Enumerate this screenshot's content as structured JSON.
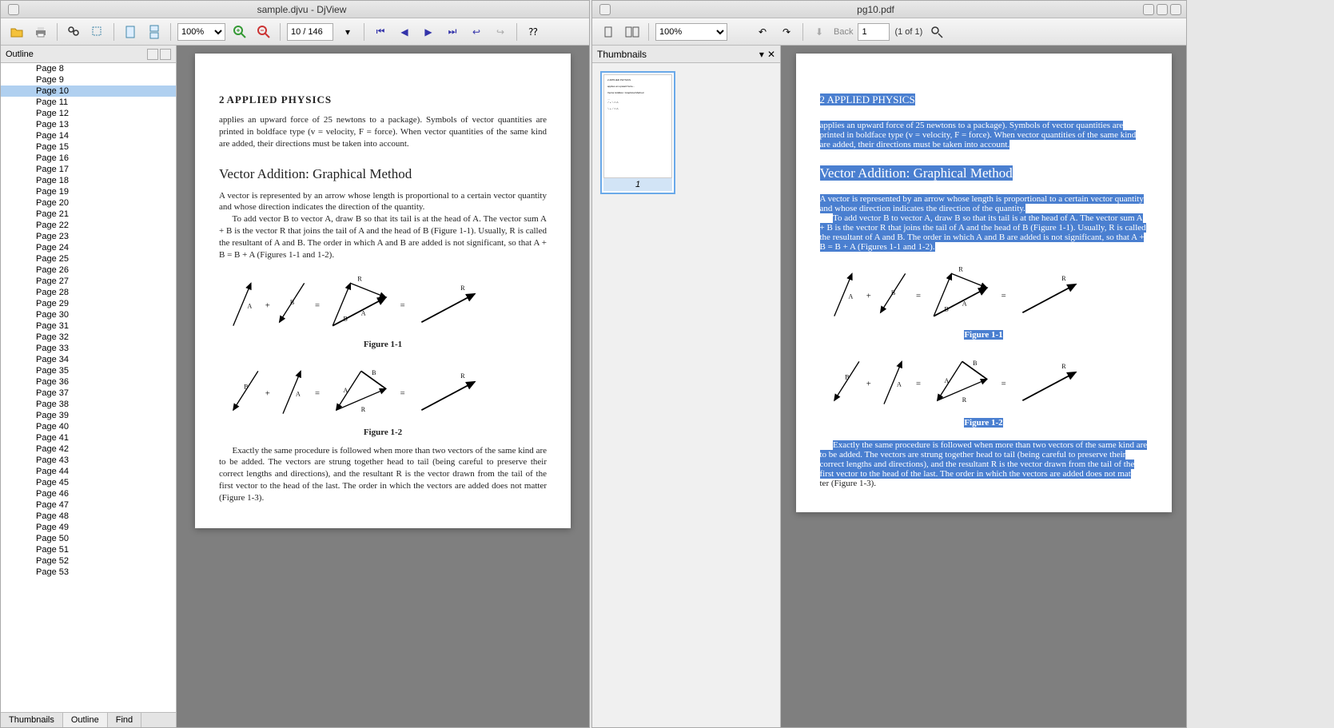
{
  "left": {
    "title": "sample.djvu - DjView",
    "toolbar": {
      "zoom": "100%",
      "page_field": "10 / 146"
    },
    "sidebar": {
      "header": "Outline",
      "tabs": [
        "Thumbnails",
        "Outline",
        "Find"
      ],
      "active_tab": 1,
      "selected_page": "Page 10",
      "pages": [
        "Page 8",
        "Page 9",
        "Page 10",
        "Page 11",
        "Page 12",
        "Page 13",
        "Page 14",
        "Page 15",
        "Page 16",
        "Page 17",
        "Page 18",
        "Page 19",
        "Page 20",
        "Page 21",
        "Page 22",
        "Page 23",
        "Page 24",
        "Page 25",
        "Page 26",
        "Page 27",
        "Page 28",
        "Page 29",
        "Page 30",
        "Page 31",
        "Page 32",
        "Page 33",
        "Page 34",
        "Page 35",
        "Page 36",
        "Page 37",
        "Page 38",
        "Page 39",
        "Page 40",
        "Page 41",
        "Page 42",
        "Page 43",
        "Page 44",
        "Page 45",
        "Page 46",
        "Page 47",
        "Page 48",
        "Page 49",
        "Page 50",
        "Page 51",
        "Page 52",
        "Page 53"
      ]
    },
    "doc": {
      "chapter_num": "2",
      "chapter_title": "APPLIED PHYSICS",
      "para1": "applies an upward force of 25 newtons to a package). Symbols of vector quantities are printed in boldface type (v = velocity, F = force). When vector quantities of the same kind are added, their directions must be taken into account.",
      "h2": "Vector Addition: Graphical Method",
      "para2a": "A vector is represented by an arrow whose length is proportional to a certain vector quantity and whose direction indicates the direction of the quantity.",
      "para2b": "To add vector B to vector A, draw B so that its tail is at the head of A. The vector sum A + B is the vector R that joins the tail of A and the head of B (Figure 1-1). Usually, R is called the resultant of A and B. The order in which A and B are added is not significant, so that A + B = B + A (Figures 1-1 and 1-2).",
      "fig1": "Figure 1-1",
      "fig2": "Figure 1-2",
      "para3": "Exactly the same procedure is followed when more than two vectors of the same kind are to be added. The vectors are strung together head to tail (being careful to preserve their correct lengths and directions), and the resultant R is the vector drawn from the tail of the first vector to the head of the last. The order in which the vectors are added does not matter (Figure 1-3)."
    }
  },
  "right": {
    "title": "pg10.pdf",
    "toolbar": {
      "zoom": "100%",
      "back_label": "Back",
      "page_field": "1",
      "page_count": "(1 of 1)"
    },
    "thumb": {
      "header": "Thumbnails",
      "thumb_num": "1"
    },
    "doc": {
      "chapter": "2 APPLIED PHYSICS",
      "para1": "applies an upward force of 25 newtons to a package). Symbols of vector quantities are printed in boldface type (v = velocity, F = force). When vector quantities of the same kind are added, their directions must be taken into account.",
      "h2": "Vector Addition: Graphical Method",
      "para2a": "A vector is represented by an arrow whose length is proportional to a certain vector quantity and whose direction indicates the direction of the quantity.",
      "para2b": "To add vector B to vector A, draw B so that its tail is at the head of A. The vector sum A + B is the vector R that joins the tail of A and the head of B (Figure 1-1). Usually, R is called the resultant of A and B. The order in which A and B are added is not significant, so that A + B = B + A (Figures 1-1 and 1-2).",
      "fig1": "Figure 1-1",
      "fig2": "Figure 1-2",
      "para3a": "Exactly the same procedure is followed when more than two vectors of the same kind are to be added. The vectors are strung together head to tail (being careful to preserve their correct lengths and directions), and the resultant R is the vector drawn from the tail of the first vector to the head of the last. The order in which the vectors are added does not mat",
      "para3b": "ter (Figure 1-3)."
    }
  }
}
